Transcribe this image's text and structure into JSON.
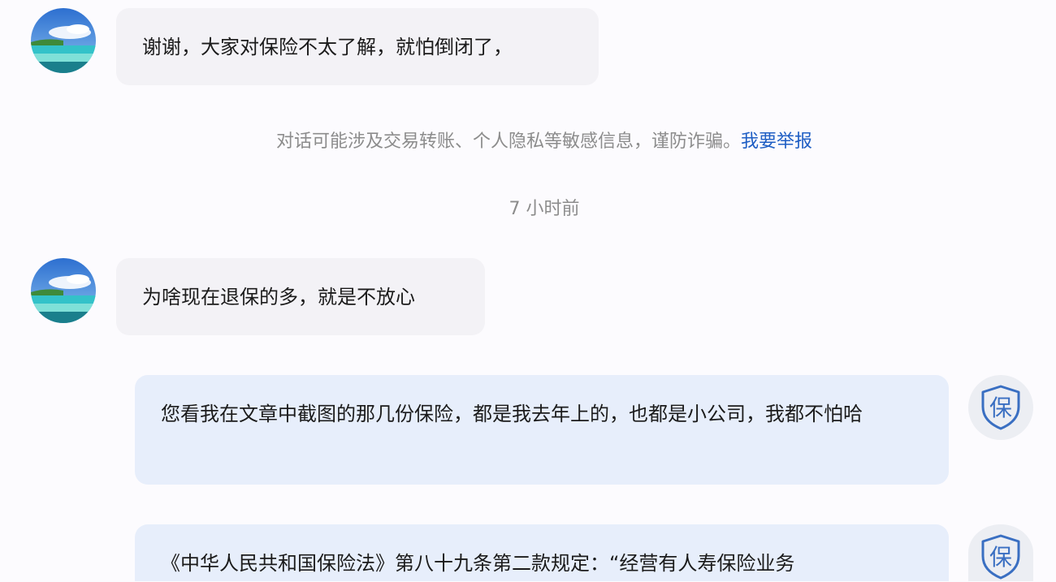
{
  "messages": [
    {
      "side": "left",
      "sender": "user",
      "text": "谢谢，大家对保险不太了解，就怕倒闭了，"
    },
    {
      "side": "left",
      "sender": "user",
      "text": "为啥现在退保的多，就是不放心"
    },
    {
      "side": "right",
      "sender": "advisor",
      "text": "您看我在文章中截图的那几份保险，都是我去年上的，也都是小公司，我都不怕哈"
    },
    {
      "side": "right",
      "sender": "advisor",
      "text": "《中华人民共和国保险法》第八十九条第二款规定：“经营有人寿保险业务"
    }
  ],
  "notice": {
    "text": "对话可能涉及交易转账、个人隐私等敏感信息，谨防诈骗。",
    "link": "我要举报"
  },
  "timestamp": "7 小时前",
  "advisor_avatar": {
    "glyph": "保",
    "icon": "shield-icon"
  },
  "colors": {
    "background": "#fcfbfe",
    "left_bubble": "#f3f2f6",
    "right_bubble": "#e7eefb",
    "link": "#1e5ec4",
    "muted": "#8c8c8c",
    "shield": "#3a6fc2"
  }
}
